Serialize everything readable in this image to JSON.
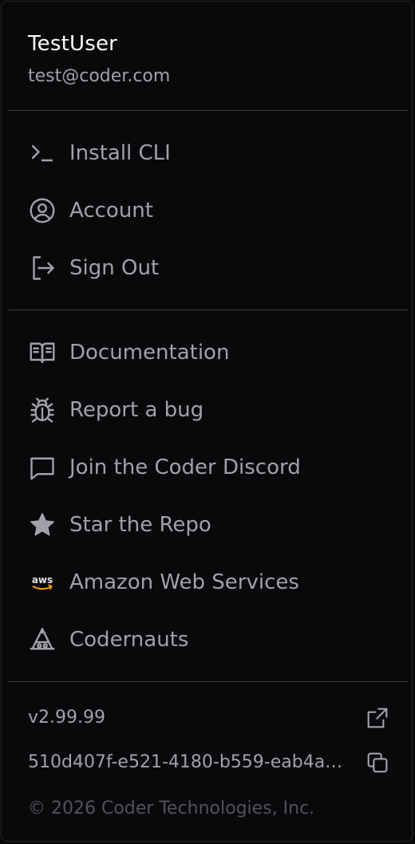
{
  "user": {
    "name": "TestUser",
    "email": "test@coder.com"
  },
  "account_menu": [
    {
      "label": "Install CLI",
      "icon": "terminal-icon"
    },
    {
      "label": "Account",
      "icon": "user-circle-icon"
    },
    {
      "label": "Sign Out",
      "icon": "sign-out-icon"
    }
  ],
  "support_links": [
    {
      "label": "Documentation",
      "icon": "book-icon"
    },
    {
      "label": "Report a bug",
      "icon": "bug-icon"
    },
    {
      "label": "Join the Coder Discord",
      "icon": "chat-icon"
    },
    {
      "label": "Star the Repo",
      "icon": "star-icon"
    },
    {
      "label": "Amazon Web Services",
      "icon": "aws-icon"
    },
    {
      "label": "Codernauts",
      "icon": "codernauts-icon"
    }
  ],
  "footer": {
    "version": "v2.99.99",
    "build_id": "510d407f-e521-4180-b559-eab4a…",
    "copyright": "© 2026 Coder Technologies, Inc.",
    "version_link_icon": "external-link-icon",
    "copy_icon": "copy-icon"
  },
  "colors": {
    "background": "#09090b",
    "divider": "#3f3f46",
    "text_primary": "#fafafa",
    "text_secondary": "#a1a1aa",
    "text_muted": "#52525b"
  }
}
